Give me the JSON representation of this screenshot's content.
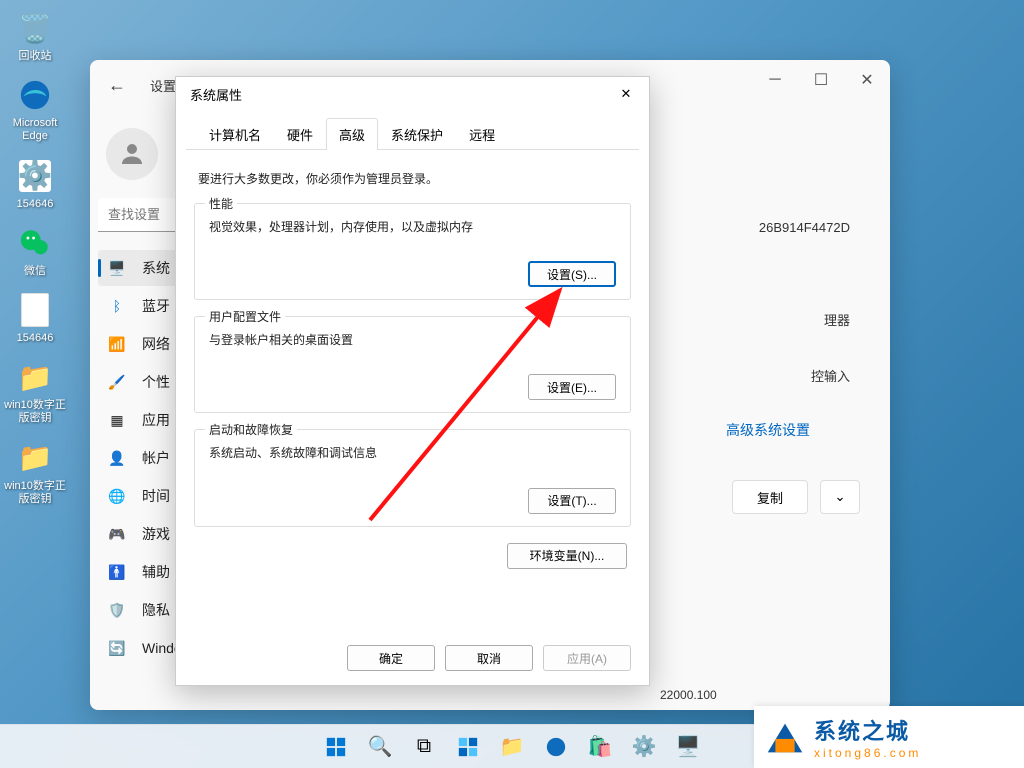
{
  "desktop": {
    "items": [
      {
        "label": "回收站"
      },
      {
        "label": "Microsoft Edge"
      },
      {
        "label": "154646"
      },
      {
        "label": "微信"
      },
      {
        "label": "154646"
      },
      {
        "label": "win10数字正版密钥"
      },
      {
        "label": "win10数字正版密钥"
      }
    ]
  },
  "settings": {
    "title": "设置",
    "search_placeholder": "查找设置",
    "nav": [
      {
        "label": "系统"
      },
      {
        "label": "蓝牙"
      },
      {
        "label": "网络"
      },
      {
        "label": "个性"
      },
      {
        "label": "应用"
      },
      {
        "label": "帐户"
      },
      {
        "label": "时间"
      },
      {
        "label": "游戏"
      },
      {
        "label": "辅助"
      },
      {
        "label": "隐私"
      },
      {
        "label": "Windows 更新"
      }
    ],
    "content": {
      "product_id_fragment": "26B914F4472D",
      "cpu_label": "理器",
      "touch_label": "控输入",
      "advanced_link": "高级系统设置",
      "copy_btn": "复制",
      "version": "22000.100"
    }
  },
  "sysprops": {
    "title": "系统属性",
    "tabs": [
      "计算机名",
      "硬件",
      "高级",
      "系统保护",
      "远程"
    ],
    "active_tab": "高级",
    "admin_note": "要进行大多数更改，你必须作为管理员登录。",
    "groups": {
      "perf": {
        "title": "性能",
        "desc": "视觉效果，处理器计划，内存使用，以及虚拟内存",
        "btn": "设置(S)..."
      },
      "profile": {
        "title": "用户配置文件",
        "desc": "与登录帐户相关的桌面设置",
        "btn": "设置(E)..."
      },
      "startup": {
        "title": "启动和故障恢复",
        "desc": "系统启动、系统故障和调试信息",
        "btn": "设置(T)..."
      }
    },
    "env_btn": "环境变量(N)...",
    "footer": {
      "ok": "确定",
      "cancel": "取消",
      "apply": "应用(A)"
    }
  },
  "watermark": {
    "cn": "系统之城",
    "url": "xitong86.com"
  }
}
